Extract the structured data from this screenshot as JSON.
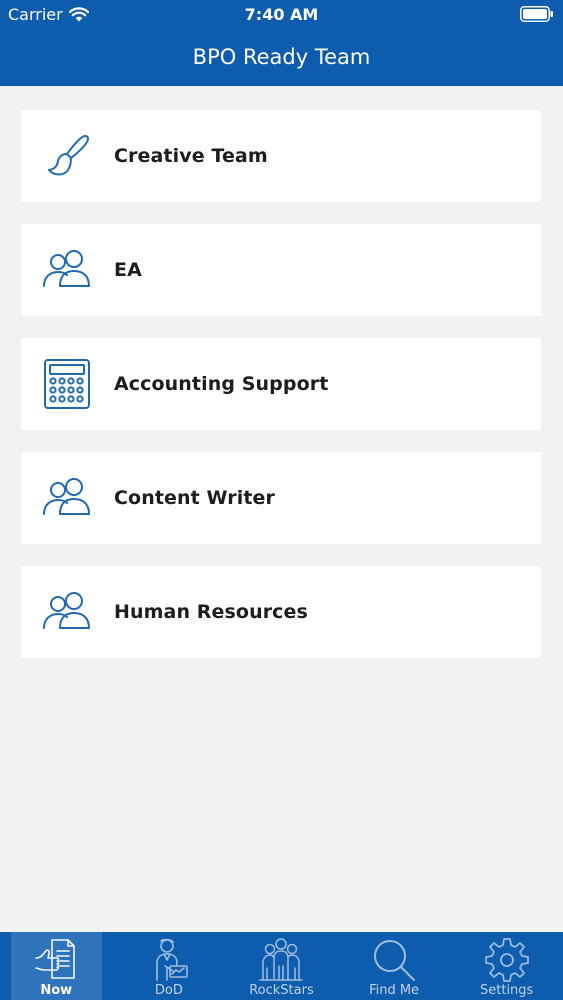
{
  "status_bar": {
    "carrier": "Carrier",
    "time": "7:40 AM"
  },
  "nav": {
    "title": "BPO Ready Team"
  },
  "teams": [
    {
      "label": "Creative Team",
      "icon": "paintbrush-icon"
    },
    {
      "label": "EA",
      "icon": "users-icon"
    },
    {
      "label": "Accounting Support",
      "icon": "calculator-icon"
    },
    {
      "label": "Content Writer",
      "icon": "users-icon"
    },
    {
      "label": "Human Resources",
      "icon": "users-icon"
    }
  ],
  "tabs": [
    {
      "label": "Now",
      "icon": "hand-document-icon",
      "active": true
    },
    {
      "label": "DoD",
      "icon": "presenter-icon",
      "active": false
    },
    {
      "label": "RockStars",
      "icon": "group-icon",
      "active": false
    },
    {
      "label": "Find Me",
      "icon": "search-icon",
      "active": false
    },
    {
      "label": "Settings",
      "icon": "gear-icon",
      "active": false
    }
  ],
  "colors": {
    "brand": "#0d5cad",
    "icon_blue": "#1f69b4",
    "background": "#f2f2f4"
  }
}
